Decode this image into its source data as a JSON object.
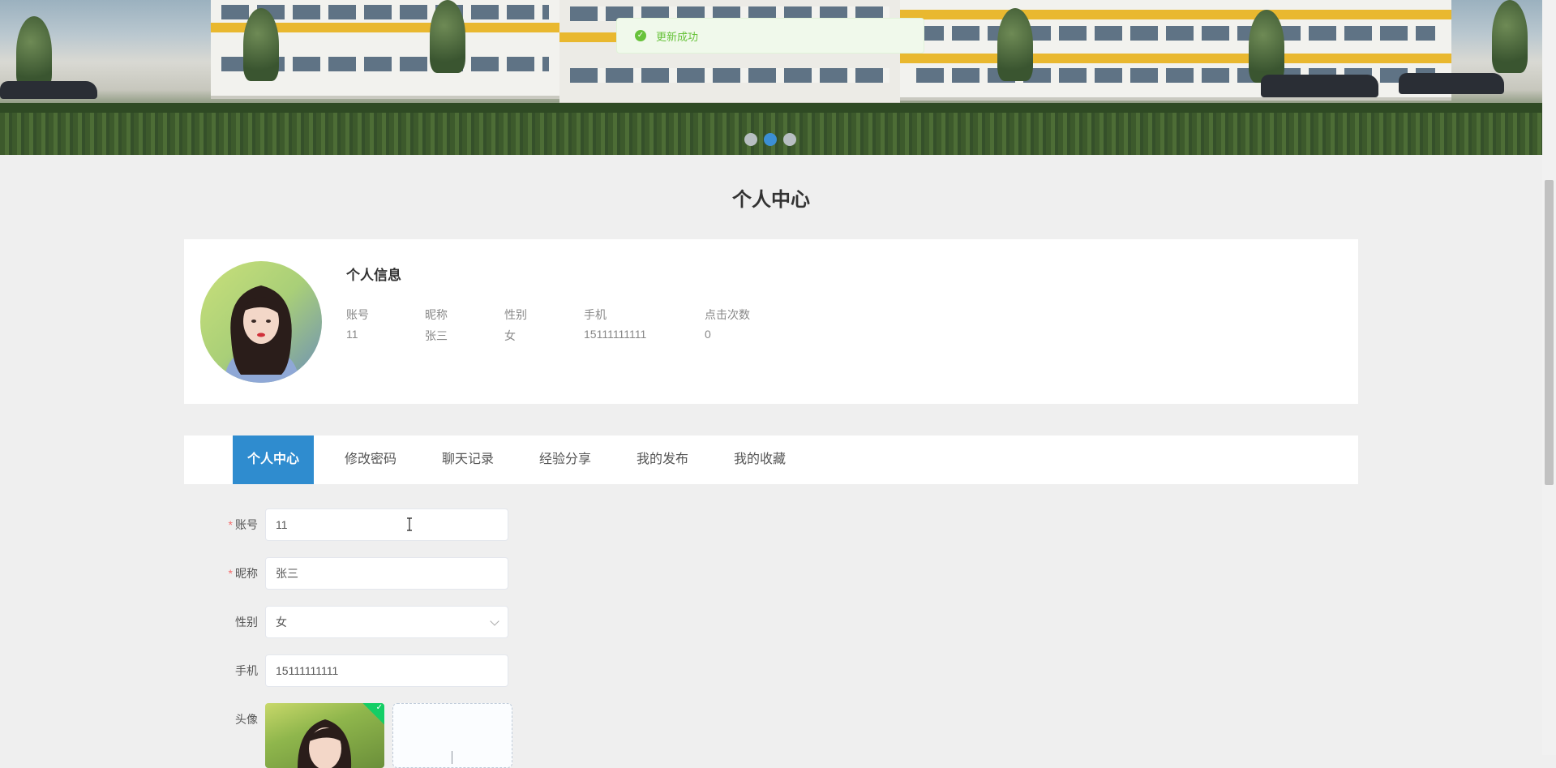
{
  "banner": {
    "dot_count": 3,
    "active_dot": 1
  },
  "toast": {
    "message": "更新成功",
    "color": "#67c23a"
  },
  "page_title": "个人中心",
  "profile": {
    "section_title": "个人信息",
    "fields": [
      {
        "label": "账号",
        "value": "11"
      },
      {
        "label": "昵称",
        "value": "张三"
      },
      {
        "label": "性别",
        "value": "女"
      },
      {
        "label": "手机",
        "value": "15111111111"
      },
      {
        "label": "点击次数",
        "value": "0"
      }
    ]
  },
  "tabs": [
    {
      "label": "个人中心",
      "active": true
    },
    {
      "label": "修改密码",
      "active": false
    },
    {
      "label": "聊天记录",
      "active": false
    },
    {
      "label": "经验分享",
      "active": false
    },
    {
      "label": "我的发布",
      "active": false
    },
    {
      "label": "我的收藏",
      "active": false
    }
  ],
  "form": {
    "account": {
      "label": "账号",
      "value": "11",
      "required": true
    },
    "nickname": {
      "label": "昵称",
      "value": "张三",
      "required": true
    },
    "gender": {
      "label": "性别",
      "value": "女"
    },
    "phone": {
      "label": "手机",
      "value": "15111111111"
    },
    "avatar": {
      "label": "头像"
    }
  },
  "colors": {
    "accent": "#2f8ccf",
    "success": "#67c23a",
    "required": "#f56c6c"
  }
}
